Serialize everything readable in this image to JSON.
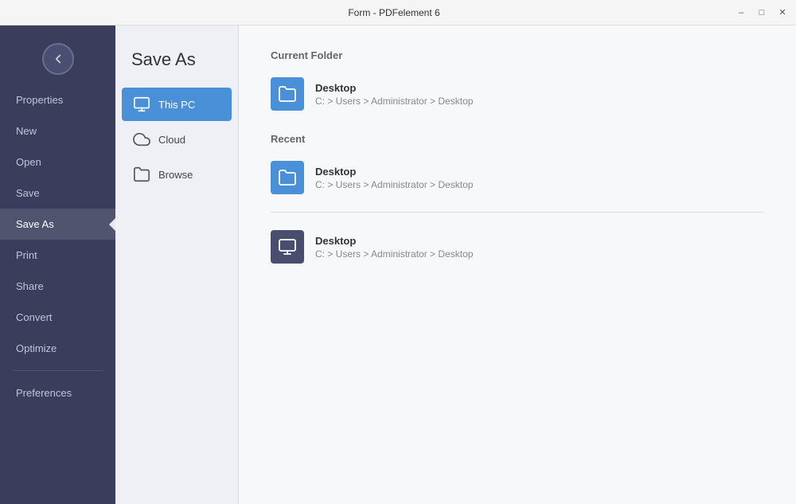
{
  "titleBar": {
    "title": "Form - PDFelement 6",
    "minimize": "–",
    "maximize": "□",
    "close": "✕"
  },
  "sidebar": {
    "items": [
      {
        "id": "properties",
        "label": "Properties"
      },
      {
        "id": "new",
        "label": "New"
      },
      {
        "id": "open",
        "label": "Open"
      },
      {
        "id": "save",
        "label": "Save"
      },
      {
        "id": "save-as",
        "label": "Save As",
        "active": true
      },
      {
        "id": "print",
        "label": "Print"
      },
      {
        "id": "share",
        "label": "Share"
      },
      {
        "id": "convert",
        "label": "Convert"
      },
      {
        "id": "optimize",
        "label": "Optimize"
      }
    ],
    "bottomItems": [
      {
        "id": "preferences",
        "label": "Preferences"
      }
    ]
  },
  "panel": {
    "title": "Save As",
    "items": [
      {
        "id": "this-pc",
        "label": "This PC",
        "active": true
      },
      {
        "id": "cloud",
        "label": "Cloud"
      },
      {
        "id": "browse",
        "label": "Browse"
      }
    ]
  },
  "content": {
    "currentFolderLabel": "Current Folder",
    "recentLabel": "Recent",
    "currentFolder": {
      "name": "Desktop",
      "path": "C: > Users > Administrator > Desktop"
    },
    "recentItems": [
      {
        "name": "Desktop",
        "path": "C: > Users > Administrator > Desktop",
        "style": "blue"
      },
      {
        "name": "Desktop",
        "path": "C: > Users > Administrator > Desktop",
        "style": "dark"
      }
    ]
  }
}
